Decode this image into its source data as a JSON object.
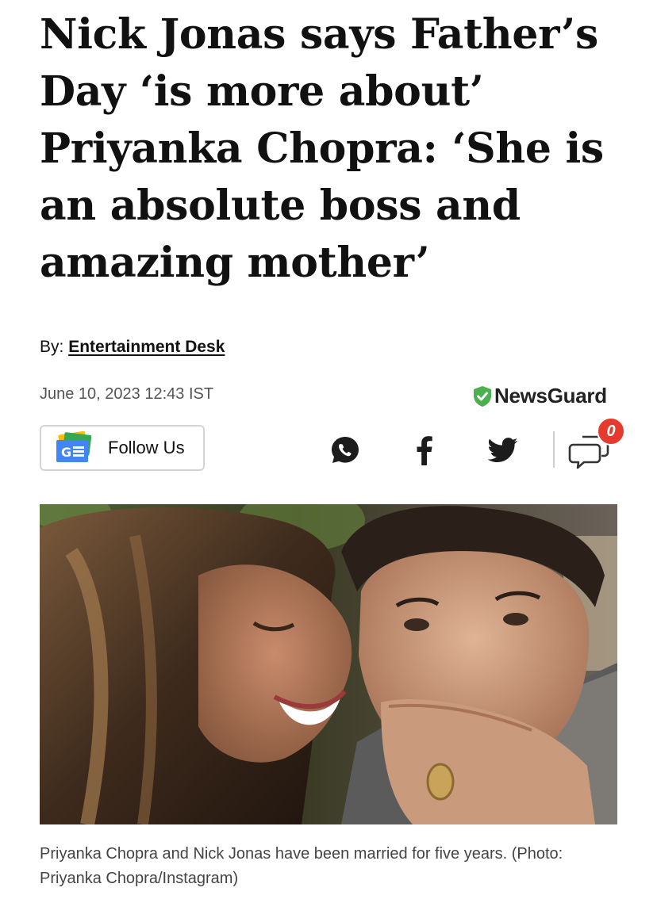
{
  "article": {
    "headline": "Nick Jonas says Father’s Day ‘is more about’ Priyanka Chopra: ‘She is an absolute boss and amazing mother’",
    "byline_prefix": "By:",
    "author": "Entertainment Desk",
    "date": "June 10, 2023 12:43 IST",
    "caption": "Priyanka Chopra and Nick Jonas have been married for five years. (Photo: Priyanka Chopra/Instagram)"
  },
  "newsguard": {
    "label": "NewsGuard",
    "icon": "shield-check-icon",
    "color": "#4caf50"
  },
  "follow": {
    "label": "Follow Us",
    "logo_text": "G☰",
    "icon": "google-news-icon"
  },
  "share": {
    "icons": [
      "whatsapp-icon",
      "facebook-icon",
      "twitter-icon",
      "comments-icon"
    ],
    "comment_count": "0",
    "badge_color": "#e53a2d"
  }
}
